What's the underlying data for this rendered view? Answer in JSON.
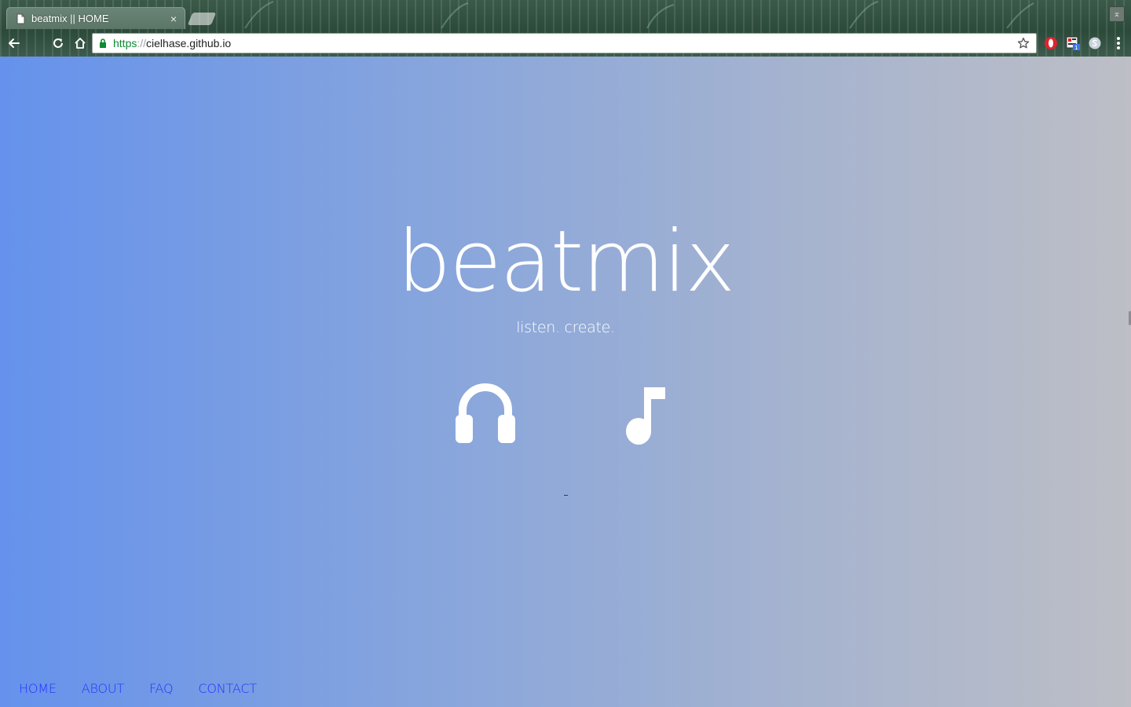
{
  "browser": {
    "tab_title": "beatmix || HOME",
    "tab_close": "×",
    "url_scheme": "https",
    "url_separator": "://",
    "url_host": "cielhase.github.io",
    "window_button_label": "⌅",
    "icons": {
      "tab": "document-icon",
      "back": "back-arrow-icon",
      "reload": "reload-icon",
      "home": "home-icon",
      "secure": "lock-icon",
      "bookmark": "star-icon",
      "extensions": [
        "opera-icon",
        "extension-badge-icon",
        "skype-icon"
      ],
      "menu": "kebab-menu-icon"
    },
    "extension_badge_count": "1"
  },
  "colors": {
    "gradient_left": "#6592ec",
    "gradient_right": "#bdbec6",
    "foreground": "#ffffff",
    "nav_link": "#2530ff",
    "secure_green": "#0d8a33"
  },
  "hero": {
    "title": "beatmix",
    "tagline": "listen. create.",
    "divider": "-",
    "actions": [
      {
        "icon": "headphones-icon"
      },
      {
        "icon": "music-note-icon"
      }
    ]
  },
  "footer_nav": [
    {
      "label": "HOME"
    },
    {
      "label": "ABOUT"
    },
    {
      "label": "FAQ"
    },
    {
      "label": "CONTACT"
    }
  ]
}
